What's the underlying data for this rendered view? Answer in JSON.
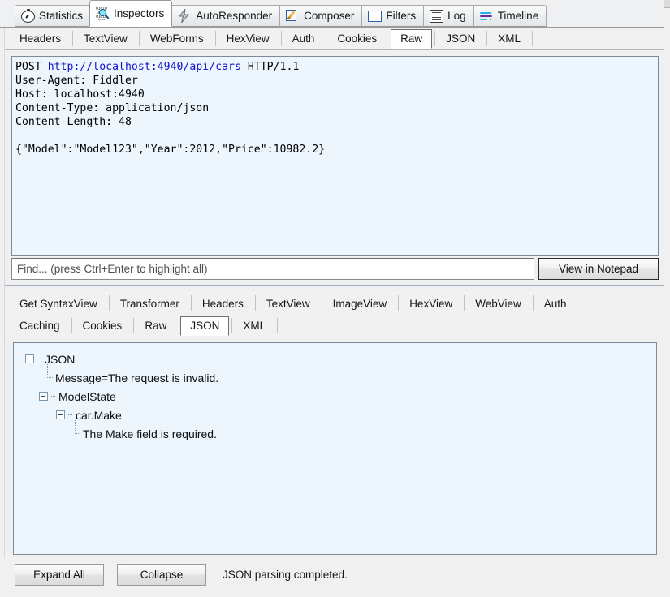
{
  "main_tabs": [
    {
      "label": "Statistics",
      "icon": "stopwatch-icon",
      "selected": false
    },
    {
      "label": "Inspectors",
      "icon": "magnifier-binary-icon",
      "selected": true
    },
    {
      "label": "AutoResponder",
      "icon": "lightning-bolt-icon",
      "selected": false
    },
    {
      "label": "Composer",
      "icon": "pencil-page-icon",
      "selected": false
    },
    {
      "label": "Filters",
      "icon": "square-outline-icon",
      "selected": false
    },
    {
      "label": "Log",
      "icon": "document-lines-icon",
      "selected": false
    },
    {
      "label": "Timeline",
      "icon": "timeline-bars-icon",
      "selected": false
    }
  ],
  "request": {
    "tabs": [
      {
        "label": "Headers",
        "selected": false
      },
      {
        "label": "TextView",
        "selected": false
      },
      {
        "label": "WebForms",
        "selected": false
      },
      {
        "label": "HexView",
        "selected": false
      },
      {
        "label": "Auth",
        "selected": false
      },
      {
        "label": "Cookies",
        "selected": false
      },
      {
        "label": "Raw",
        "selected": true
      },
      {
        "label": "JSON",
        "selected": false
      },
      {
        "label": "XML",
        "selected": false
      }
    ],
    "raw": {
      "method": "POST",
      "url": "http://localhost:4940/api/cars",
      "version": "HTTP/1.1",
      "headers": [
        "User-Agent: Fiddler",
        "Host: localhost:4940",
        "Content-Type: application/json",
        "Content-Length: 48"
      ],
      "body": "{\"Model\":\"Model123\",\"Year\":2012,\"Price\":10982.2}"
    },
    "find_placeholder": "Find... (press Ctrl+Enter to highlight all)",
    "find_value": "",
    "view_in_notepad_label": "View in Notepad"
  },
  "response": {
    "tabs_row1": [
      {
        "label": "Get SyntaxView",
        "selected": false
      },
      {
        "label": "Transformer",
        "selected": false
      },
      {
        "label": "Headers",
        "selected": false
      },
      {
        "label": "TextView",
        "selected": false
      },
      {
        "label": "ImageView",
        "selected": false
      },
      {
        "label": "HexView",
        "selected": false
      },
      {
        "label": "WebView",
        "selected": false
      },
      {
        "label": "Auth",
        "selected": false
      }
    ],
    "tabs_row2": [
      {
        "label": "Caching",
        "selected": false
      },
      {
        "label": "Cookies",
        "selected": false
      },
      {
        "label": "Raw",
        "selected": false
      },
      {
        "label": "JSON",
        "selected": true
      },
      {
        "label": "XML",
        "selected": false
      }
    ],
    "json_tree": {
      "root_label": "JSON",
      "message_node": "Message=The request is invalid.",
      "modelstate_label": "ModelState",
      "carmake_label": "car.Make",
      "carmake_value": "The Make field is required."
    },
    "expand_all_label": "Expand All",
    "collapse_label": "Collapse",
    "status": "JSON parsing completed."
  },
  "colors": {
    "pane_background": "#eef6fd",
    "url_link": "#1111cc",
    "tree_line": "#7b96b3",
    "window_chrome": "#f0f0f0",
    "selected_tab": "#ffffff"
  }
}
